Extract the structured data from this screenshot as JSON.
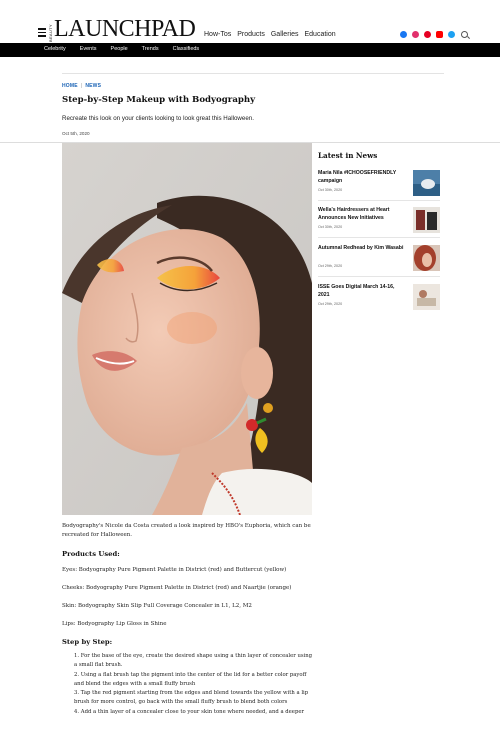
{
  "header": {
    "brand_small": "BEAUTY",
    "brand": "LAUNCHPAD",
    "nav": [
      "How-Tos",
      "Products",
      "Galleries",
      "Education"
    ],
    "social": [
      {
        "name": "facebook-icon",
        "color": "#1877f2"
      },
      {
        "name": "instagram-icon",
        "color": "#e1306c"
      },
      {
        "name": "pinterest-icon",
        "color": "#e60023"
      },
      {
        "name": "youtube-icon",
        "color": "#ff0000"
      },
      {
        "name": "twitter-icon",
        "color": "#1da1f2"
      }
    ],
    "subnav": [
      "Celebrity",
      "Events",
      "People",
      "Trends",
      "Classifieds"
    ]
  },
  "article": {
    "breadcrumb_home": "HOME",
    "breadcrumb_section": "NEWS",
    "title": "Step-by-Step Makeup with Bodyography",
    "dek": "Recreate this look on your clients looking to look great this Halloween.",
    "date": "Oct 5th, 2020",
    "intro_link1": "Bodyography",
    "intro_text1": "'s ",
    "intro_link2": "Nicole da Costa",
    "intro_text2": " created a look inspired by HBO's ",
    "intro_link3": "Euphoria",
    "intro_text3": ", which can be recreated for Halloween.",
    "products_heading": "Products Used:",
    "eyes_pre": "Eyes: Bodyography ",
    "eyes_link": "Pure Pigment Palette",
    "eyes_post": " in District (red) and Buttercut (yellow)",
    "cheeks": "Cheeks: Bodyography Pure Pigment Palette in District (red) and Naartjie (orange)",
    "skin_pre": "Skin: Bodyography ",
    "skin_link": "Skin Slip Full Coverage Concealer",
    "skin_post": " in L1, L2, M2",
    "lips_pre": "Lips: Bodyography ",
    "lips_link": "Lip Gloss",
    "lips_post": " in Shine",
    "steps_heading": "Step by Step:",
    "steps": [
      "1. For the base of the eye, create the desired shape using a thin layer of concealer using a small flat brush.",
      "2. Using a flat brush tap the pigment into the center of the lid for a better color payoff and blend the edges with a small fluffy brush",
      "3. Tap the red pigment starting from the edges and blend towards the yellow with a lip brush for more control, go back with the small fluffy brush to blend both colors",
      "4. Add a thin layer of a concealer close to your skin tone where needed, and a deeper"
    ]
  },
  "sidebar": {
    "title": "Latest in News",
    "items": [
      {
        "title": "Maria Nila #ICHOOSEFRIENDLY campaign",
        "date": "Oct 30th, 2020"
      },
      {
        "title": "Wella's Hairdressers at Heart Announces New Initiatives",
        "date": "Oct 30th, 2020"
      },
      {
        "title": "Autumnal Redhead by Kim Wasabi",
        "date": "Oct 29th, 2020"
      },
      {
        "title": "ISSE Goes Digital March 14-16, 2021",
        "date": "Oct 29th, 2020"
      }
    ]
  },
  "colors": {
    "link": "#1a63b5",
    "subnav_bg": "#000000"
  }
}
